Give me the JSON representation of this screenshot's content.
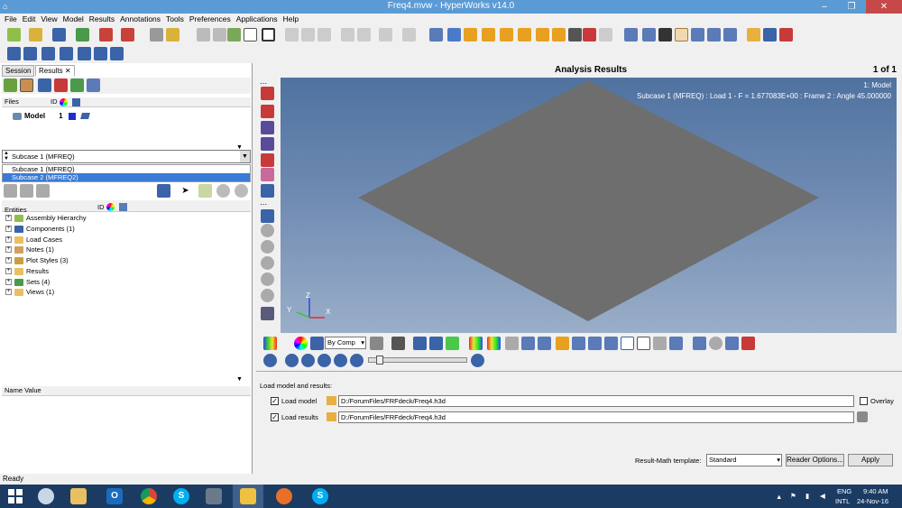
{
  "window": {
    "title": "Freq4.mvw - HyperWorks v14.0",
    "minimize": "–",
    "maximize": "❐",
    "close": "✕"
  },
  "menu": [
    "File",
    "Edit",
    "View",
    "Model",
    "Results",
    "Annotations",
    "Tools",
    "Preferences",
    "Applications",
    "Help"
  ],
  "left": {
    "tabs": [
      {
        "label": "Session"
      },
      {
        "label": "Results"
      }
    ],
    "files_header": "Files",
    "id_label": "ID",
    "model_label": "Model",
    "model_id": "1",
    "subcase_selected": "Subcase 1 (MFREQ)",
    "subcase_options": [
      "Subcase 1 (MFREQ)",
      "Subcase 2 (MFREQ2)"
    ],
    "entities_header": "Entities",
    "entities": [
      "Assembly Hierarchy",
      "Components (1)",
      "Load Cases",
      "Notes (1)",
      "Plot Styles (3)",
      "Results",
      "Sets  (4)",
      "Views (1)"
    ],
    "name_value_header": "Name Value"
  },
  "viewport": {
    "title": "Analysis Results",
    "page": "1 of 1",
    "model_label": "1: Model",
    "subcase_info": "Subcase 1 (MFREQ) : Load 1 - F = 1.677083E+00 : Frame 2 : Angle 45.000000",
    "axis_z": "Z",
    "axis_x": "X",
    "axis_y": "Y",
    "plate_color": "#6e6e6e"
  },
  "toolbar": {
    "by_comp": "By Comp"
  },
  "load": {
    "section_label": "Load model and results:",
    "load_model_label": "Load model",
    "load_model_path": "D:/ForumFiles/FRFdeck/Freq4.h3d",
    "load_results_label": "Load results",
    "load_results_path": "D:/ForumFiles/FRFdeck/Freq4.h3d",
    "overlay_label": "Overlay",
    "template_label": "Result-Math template:",
    "template_value": "Standard",
    "reader_options": "Reader Options...",
    "apply": "Apply"
  },
  "status": "Ready",
  "taskbar": {
    "tray_lang1": "ENG",
    "tray_lang2": "INTL",
    "time": "9:40 AM",
    "date": "24-Nov-16"
  }
}
